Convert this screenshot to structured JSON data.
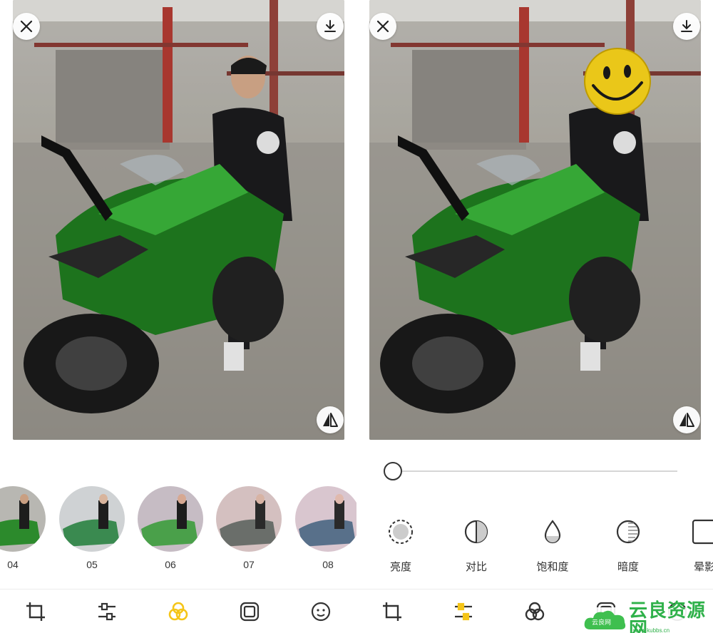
{
  "left_panel": {
    "filters": [
      {
        "label": "04"
      },
      {
        "label": "05"
      },
      {
        "label": "06"
      },
      {
        "label": "07"
      },
      {
        "label": "08"
      }
    ],
    "selected_tool": "filter"
  },
  "right_panel": {
    "slider": {
      "value": 0
    },
    "adjustments": [
      {
        "label": "亮度",
        "icon": "brightness-icon"
      },
      {
        "label": "对比",
        "icon": "contrast-icon"
      },
      {
        "label": "饱和度",
        "icon": "saturation-icon"
      },
      {
        "label": "暗度",
        "icon": "darkness-icon"
      },
      {
        "label": "晕影",
        "icon": "vignette-icon"
      }
    ],
    "selected_tool": "adjust"
  },
  "toolbar": {
    "tools": [
      "crop-icon",
      "adjust-icon",
      "filter-icon",
      "frame-icon",
      "face-icon"
    ]
  },
  "colors": {
    "accent": "#f5c518",
    "icon": "#333333",
    "watermark_green": "#2fb14a"
  },
  "watermark": {
    "main": "云良资源网",
    "sub": "www.kubbs.cn",
    "badge": "云良网"
  }
}
